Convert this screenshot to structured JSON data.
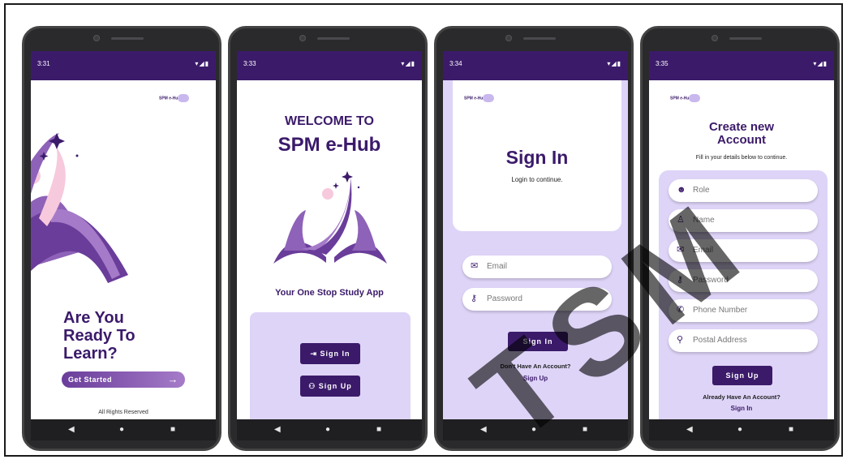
{
  "colors": {
    "brand": "#3b1a6a",
    "light_purple": "#ded4f7",
    "accent_pink": "#f7c9dc",
    "gradient_start": "#8e62b8"
  },
  "phone1": {
    "time": "3:31",
    "logo": "SPM e-Hub",
    "headline": [
      "Are You",
      "Ready To",
      "Learn?"
    ],
    "cta": "Get Started",
    "footer": "All Rights Reserved"
  },
  "phone2": {
    "time": "3:33",
    "welcome": "WELCOME TO",
    "app_name": "SPM e-Hub",
    "tagline": "Your One Stop Study App",
    "sign_in": "Sign In",
    "sign_up": "Sign Up"
  },
  "phone3": {
    "time": "3:34",
    "logo": "SPM e-Hub",
    "title": "Sign In",
    "subtitle": "Login to continue.",
    "email_placeholder": "Email",
    "password_placeholder": "Password",
    "button": "Sign In",
    "no_account": "Don't Have An Account?",
    "signup_link": "Sign Up"
  },
  "phone4": {
    "time": "3:35",
    "logo": "SPM e-Hub",
    "title_line1": "Create new",
    "title_line2": "Account",
    "subtitle": "Fill in your details below to continue.",
    "fields": [
      "Role",
      "Name",
      "Email",
      "Password",
      "Phone Number",
      "Postal Address"
    ],
    "button": "Sign Up",
    "have_account": "Already Have An Account?",
    "signin_link": "Sign In"
  },
  "watermark": "TSM"
}
